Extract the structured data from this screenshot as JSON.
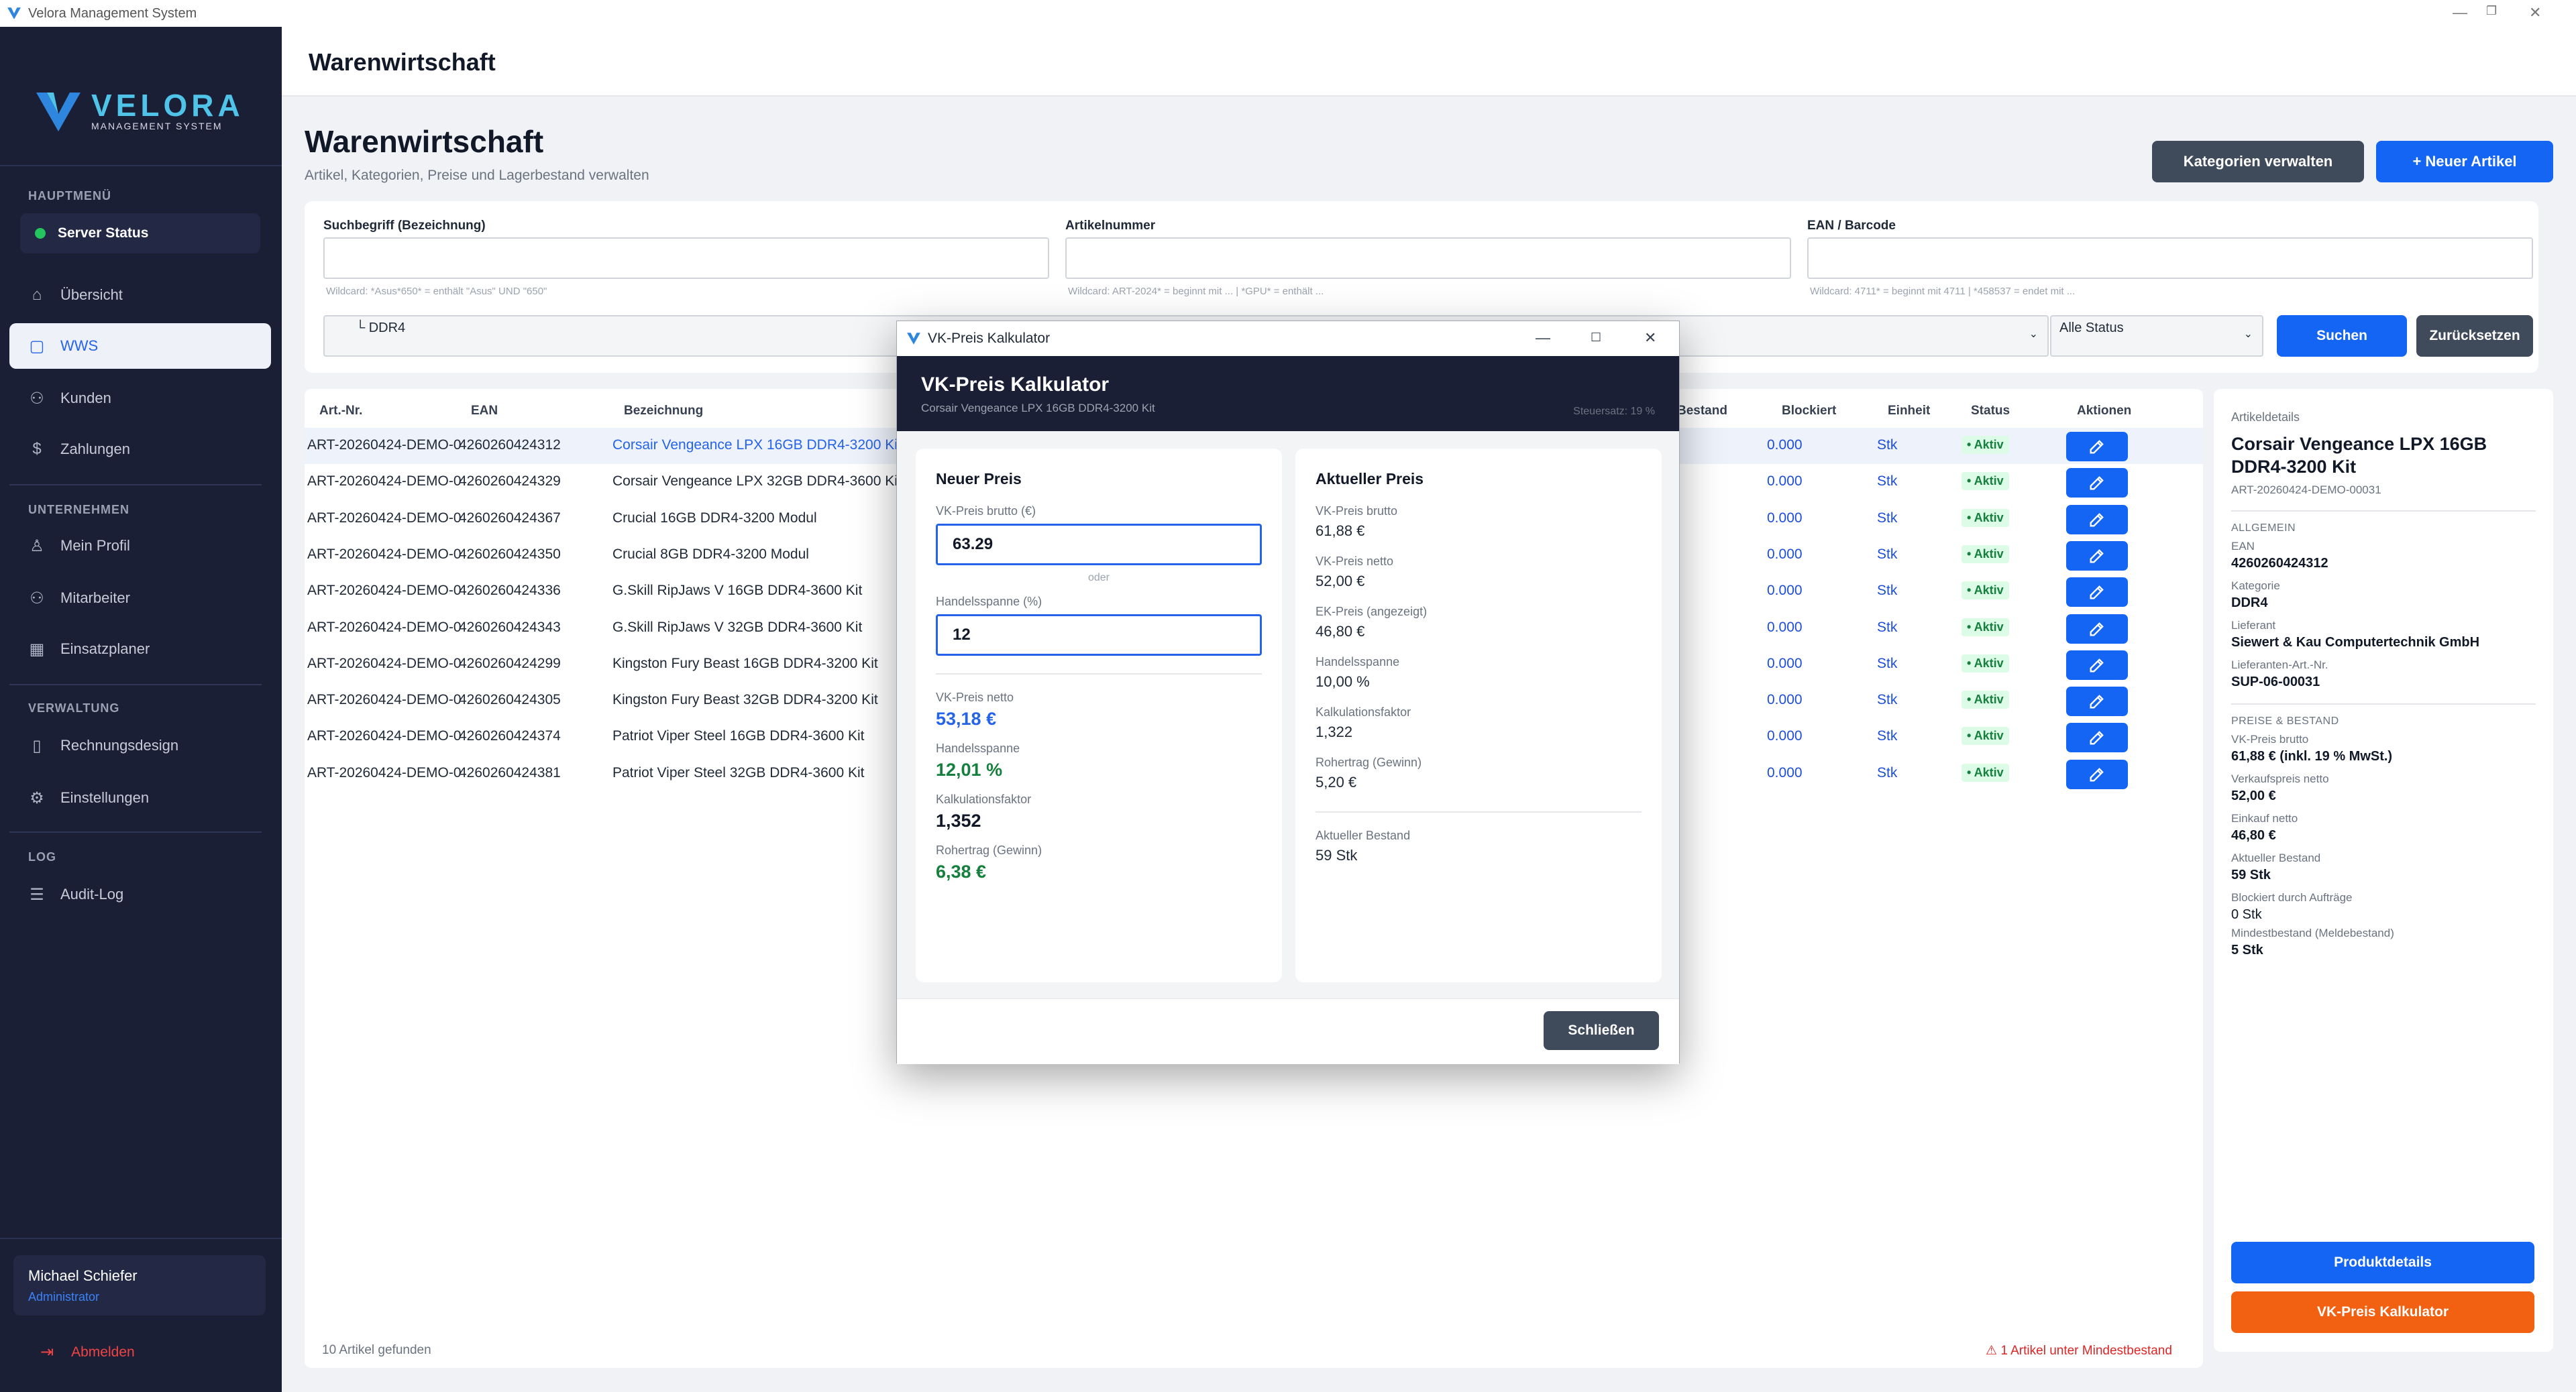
{
  "window": {
    "title": "Velora Management System"
  },
  "brand": {
    "name": "VELORA",
    "tagline": "MANAGEMENT SYSTEM"
  },
  "sidebar": {
    "sections": {
      "main": "HAUPTMENÜ",
      "company": "UNTERNEHMEN",
      "admin": "VERWALTUNG",
      "log": "LOG"
    },
    "server_status": "Server Status",
    "items": {
      "overview": "Übersicht",
      "wws": "WWS",
      "customers": "Kunden",
      "payments": "Zahlungen",
      "profile": "Mein Profil",
      "staff": "Mitarbeiter",
      "planner": "Einsatzplaner",
      "invoice_design": "Rechnungsdesign",
      "settings": "Einstellungen",
      "audit": "Audit-Log"
    },
    "user": {
      "name": "Michael Schiefer",
      "role": "Administrator"
    },
    "logout": "Abmelden"
  },
  "topbar": {
    "title": "Warenwirtschaft"
  },
  "page": {
    "title": "Warenwirtschaft",
    "subtitle": "Artikel, Kategorien, Preise und Lagerbestand verwalten",
    "btn_categories": "Kategorien verwalten",
    "btn_new": "+ Neuer Artikel"
  },
  "filters": {
    "search_label": "Suchbegriff (Bezeichnung)",
    "search_hint": "Wildcard: *Asus*650* = enthält \"Asus\" UND \"650\"",
    "artno_label": "Artikelnummer",
    "artno_hint": "Wildcard: ART-2024* = beginnt mit ... | *GPU* = enthält ...",
    "ean_label": "EAN / Barcode",
    "ean_hint": "Wildcard: 4711* = beginnt mit 4711 | *458537 = endet mit ...",
    "category_value": "└ DDR4",
    "status_value": "Alle Status",
    "btn_search": "Suchen",
    "btn_reset": "Zurücksetzen"
  },
  "table": {
    "headers": {
      "artno": "Art.-Nr.",
      "ean": "EAN",
      "name": "Bezeichnung",
      "stock": "Bestand",
      "blocked": "Blockiert",
      "unit": "Einheit",
      "status": "Status",
      "actions": "Aktionen"
    },
    "rows": [
      {
        "artno": "ART-20260424-DEMO-0",
        "ean": "4260260424312",
        "name": "Corsair Vengeance LPX 16GB DDR4-3200 Kit",
        "blocked": "0.000",
        "unit": "Stk",
        "status": "Aktiv"
      },
      {
        "artno": "ART-20260424-DEMO-0",
        "ean": "4260260424329",
        "name": "Corsair Vengeance LPX 32GB DDR4-3600 Kit",
        "blocked": "0.000",
        "unit": "Stk",
        "status": "Aktiv"
      },
      {
        "artno": "ART-20260424-DEMO-0",
        "ean": "4260260424367",
        "name": "Crucial 16GB DDR4-3200 Modul",
        "blocked": "0.000",
        "unit": "Stk",
        "status": "Aktiv"
      },
      {
        "artno": "ART-20260424-DEMO-0",
        "ean": "4260260424350",
        "name": "Crucial 8GB DDR4-3200 Modul",
        "blocked": "0.000",
        "unit": "Stk",
        "status": "Aktiv"
      },
      {
        "artno": "ART-20260424-DEMO-0",
        "ean": "4260260424336",
        "name": "G.Skill RipJaws V 16GB DDR4-3600 Kit",
        "blocked": "0.000",
        "unit": "Stk",
        "status": "Aktiv"
      },
      {
        "artno": "ART-20260424-DEMO-0",
        "ean": "4260260424343",
        "name": "G.Skill RipJaws V 32GB DDR4-3600 Kit",
        "blocked": "0.000",
        "unit": "Stk",
        "status": "Aktiv"
      },
      {
        "artno": "ART-20260424-DEMO-0",
        "ean": "4260260424299",
        "name": "Kingston Fury Beast 16GB DDR4-3200 Kit",
        "blocked": "0.000",
        "unit": "Stk",
        "status": "Aktiv"
      },
      {
        "artno": "ART-20260424-DEMO-0",
        "ean": "4260260424305",
        "name": "Kingston Fury Beast 32GB DDR4-3200 Kit",
        "blocked": "0.000",
        "unit": "Stk",
        "status": "Aktiv"
      },
      {
        "artno": "ART-20260424-DEMO-0",
        "ean": "4260260424374",
        "name": "Patriot Viper Steel 16GB DDR4-3600 Kit",
        "blocked": "0.000",
        "unit": "Stk",
        "status": "Aktiv"
      },
      {
        "artno": "ART-20260424-DEMO-0",
        "ean": "4260260424381",
        "name": "Patriot Viper Steel 32GB DDR4-3600 Kit",
        "blocked": "0.000",
        "unit": "Stk",
        "status": "Aktiv"
      }
    ],
    "footer_count": "10 Artikel gefunden",
    "footer_warning": "1 Artikel unter Mindestbestand"
  },
  "details": {
    "header": "Artikeldetails",
    "title": "Corsair Vengeance LPX 16GB DDR4-3200 Kit",
    "artno": "ART-20260424-DEMO-00031",
    "sec_general": "ALLGEMEIN",
    "ean_label": "EAN",
    "ean": "4260260424312",
    "cat_label": "Kategorie",
    "cat": "DDR4",
    "supplier_label": "Lieferant",
    "supplier": "Siewert & Kau Computertechnik GmbH",
    "supart_label": "Lieferanten-Art.-Nr.",
    "supart": "SUP-06-00031",
    "sec_price": "PREISE & BESTAND",
    "vkb_label": "VK-Preis brutto",
    "vkb": "61,88 € (inkl. 19 % MwSt.)",
    "vkn_label": "Verkaufspreis netto",
    "vkn": "52,00 €",
    "ek_label": "Einkauf netto",
    "ek": "46,80 €",
    "stock_label": "Aktueller Bestand",
    "stock": "59 Stk",
    "blocked_label": "Blockiert durch Aufträge",
    "blocked": "0 Stk",
    "min_label": "Mindestbestand (Meldebestand)",
    "min": "5 Stk",
    "btn_details": "Produktdetails",
    "btn_calc": "VK-Preis Kalkulator"
  },
  "modal": {
    "window_title": "VK-Preis Kalkulator",
    "title": "VK-Preis Kalkulator",
    "subtitle": "Corsair Vengeance LPX 16GB DDR4-3200 Kit",
    "tax": "Steuersatz: 19 %",
    "new": {
      "title": "Neuer Preis",
      "gross_label": "VK-Preis brutto (€)",
      "gross_value": "63.29",
      "or": "oder",
      "margin_label": "Handelsspanne (%)",
      "margin_value": "12",
      "net_label": "VK-Preis netto",
      "net": "53,18 €",
      "span_label": "Handelsspanne",
      "span": "12,01 %",
      "factor_label": "Kalkulationsfaktor",
      "factor": "1,352",
      "profit_label": "Rohertrag (Gewinn)",
      "profit": "6,38 €"
    },
    "current": {
      "title": "Aktueller Preis",
      "gross_label": "VK-Preis brutto",
      "gross": "61,88 €",
      "net_label": "VK-Preis netto",
      "net": "52,00 €",
      "ek_label": "EK-Preis (angezeigt)",
      "ek": "46,80 €",
      "span_label": "Handelsspanne",
      "span": "10,00 %",
      "factor_label": "Kalkulationsfaktor",
      "factor": "1,322",
      "profit_label": "Rohertrag (Gewinn)",
      "profit": "5,20 €",
      "stock_label": "Aktueller Bestand",
      "stock": "59 Stk"
    },
    "btn_close": "Schließen"
  }
}
